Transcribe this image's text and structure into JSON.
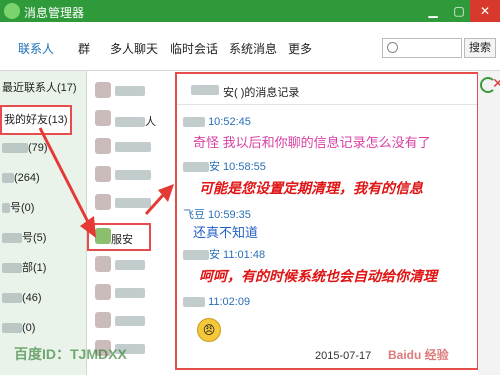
{
  "window": {
    "title": "消息管理器",
    "min_label": "▁",
    "max_label": "▢",
    "close_label": "✕"
  },
  "toolbar": {
    "tabs": [
      {
        "label": "联系人"
      },
      {
        "label": "群"
      },
      {
        "label": "多人聊天"
      },
      {
        "label": "临时会话"
      },
      {
        "label": "系统消息"
      },
      {
        "label": "更多"
      }
    ],
    "search_placeholder": "",
    "search_label": "搜索"
  },
  "sidebar": {
    "items": [
      {
        "label": "最近联系人(17)"
      },
      {
        "label": "我的好友(13)"
      },
      {
        "label": "(79)"
      },
      {
        "label": "(264)"
      },
      {
        "label": "号(0)"
      },
      {
        "label": "号(5)"
      },
      {
        "label": "部(1)"
      },
      {
        "label": "(46)"
      },
      {
        "label": "(0)"
      }
    ]
  },
  "contacts": {
    "items": [
      {
        "label": ""
      },
      {
        "label": "人"
      },
      {
        "label": ""
      },
      {
        "label": ""
      },
      {
        "label": ""
      },
      {
        "label": "服安"
      },
      {
        "label": ""
      },
      {
        "label": ""
      },
      {
        "label": ""
      },
      {
        "label": ""
      }
    ]
  },
  "history": {
    "title": "安(          )的消息记录",
    "messages": [
      {
        "sender": "10:52:45",
        "text": "奇怪 我以后和你聊的信息记录怎么没有了",
        "style": "pink"
      },
      {
        "sender": "安 10:58:55",
        "text": "可能是您设置定期清理，我有的信息",
        "style": "red"
      },
      {
        "sender": "飞豆 10:59:35",
        "text": "还真不知道",
        "style": "blue"
      },
      {
        "sender": "安 11:01:48",
        "text": "呵呵，有的时候系统也会自动给你清理",
        "style": "red"
      },
      {
        "sender": "11:02:09",
        "text": "",
        "style": "emoji"
      }
    ],
    "emoji": "😠",
    "date": "2015-07-17"
  },
  "watermark": "百度ID：TJMDXX",
  "baidu_mark": "Baidu 经验",
  "colors": {
    "accent": "#2f9a3a",
    "highlight": "#e74c4c",
    "link": "#1b6fb7"
  }
}
